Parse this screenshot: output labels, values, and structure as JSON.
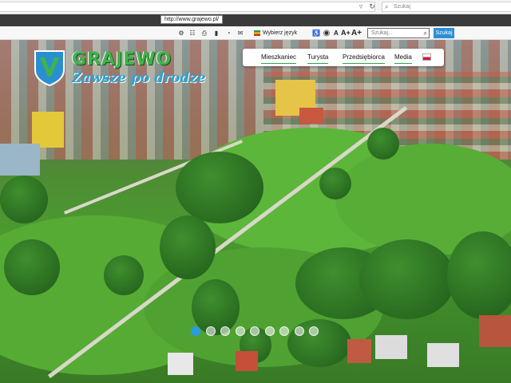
{
  "browser": {
    "tooltip_url": "http://www.grajewo.pl/",
    "search_placeholder": "Szukaj"
  },
  "toolbar": {
    "language_label": "Wybierz język",
    "font_controls": [
      "A",
      "A+",
      "A+"
    ],
    "search_placeholder": "Szukaj...",
    "search_button": "Szukaj"
  },
  "hero": {
    "title": "GRAJEWO",
    "subtitle": "Zawsze po drodze",
    "slide_count": 9,
    "active_slide": 0
  },
  "nav": {
    "items": [
      "Mieszkaniec",
      "Turysta",
      "Przedsiębiorca",
      "Media"
    ]
  },
  "colors": {
    "brand_green": "#3fb44a",
    "brand_blue": "#29a3d8",
    "accent_blue": "#2b8fd6"
  }
}
